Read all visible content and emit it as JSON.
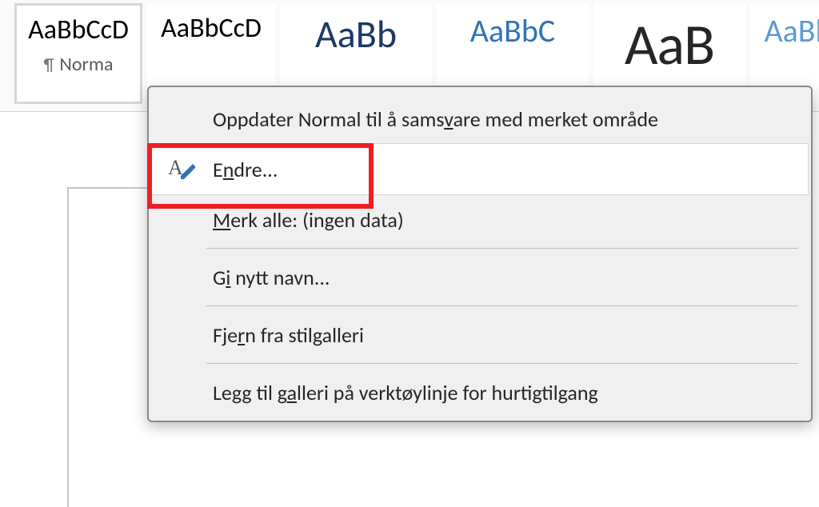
{
  "ribbon": {
    "styles": [
      {
        "preview": "AaBbCcD",
        "label": "Norma",
        "kind": "body",
        "selected": true
      },
      {
        "preview": "AaBbCcD",
        "label": "",
        "kind": "body",
        "selected": false
      },
      {
        "preview": "AaBb",
        "label": "",
        "kind": "h1",
        "selected": false
      },
      {
        "preview": "AaBbC",
        "label": "",
        "kind": "h2",
        "selected": false
      },
      {
        "preview": "AaB",
        "label": "",
        "kind": "title",
        "selected": false
      },
      {
        "preview": "AaBb",
        "label": "",
        "kind": "sub",
        "selected": false
      }
    ]
  },
  "context_menu": {
    "items": [
      {
        "id": "update",
        "parts": [
          "Oppdater Normal til å sams",
          "v",
          "are med merket område"
        ],
        "icon": null
      },
      {
        "id": "modify",
        "parts": [
          "E",
          "n",
          "dre..."
        ],
        "icon": "edit-style",
        "hovered": true
      },
      {
        "id": "select-all",
        "parts": [
          "",
          "M",
          "erk alle: (ingen data)"
        ]
      },
      {
        "id": "rename",
        "parts": [
          "G",
          "i",
          " nytt navn..."
        ]
      },
      {
        "id": "remove",
        "parts": [
          "Fje",
          "r",
          "n fra stilgalleri"
        ]
      },
      {
        "id": "add-qat",
        "parts": [
          "Legg til g",
          "a",
          "lleri på verktøylinje for hurtigtilgang"
        ]
      }
    ]
  }
}
